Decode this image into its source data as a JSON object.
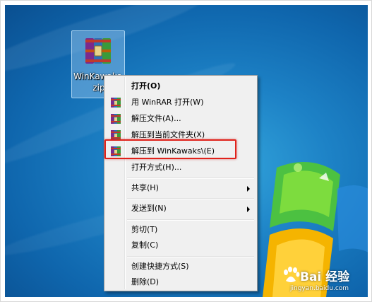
{
  "desktop": {
    "icon": {
      "name": "winrar-archive-icon",
      "label_line1": "WinKawaks.",
      "label_line2": "zip"
    }
  },
  "context_menu": {
    "items": [
      {
        "label": "打开(O)",
        "bold": true,
        "icon": ""
      },
      {
        "label": "用 WinRAR 打开(W)",
        "icon": "winrar-icon"
      },
      {
        "label": "解压文件(A)...",
        "icon": "winrar-icon"
      },
      {
        "label": "解压到当前文件夹(X)",
        "icon": "winrar-icon"
      },
      {
        "label": "解压到 WinKawaks\\(E)",
        "icon": "winrar-icon",
        "highlighted": true
      },
      {
        "label": "打开方式(H)...",
        "icon": ""
      },
      {
        "label": "共享(H)",
        "icon": "",
        "submenu": true
      },
      {
        "label": "发送到(N)",
        "icon": "",
        "submenu": true
      },
      {
        "label": "剪切(T)",
        "icon": ""
      },
      {
        "label": "复制(C)",
        "icon": ""
      },
      {
        "label": "创建快捷方式(S)",
        "icon": ""
      },
      {
        "label": "删除(D)",
        "icon": ""
      }
    ]
  },
  "watermark": {
    "brand": "Bai 经验",
    "url": "jingyan.baidu.com"
  },
  "colors": {
    "highlight_border": "#e0221b",
    "menu_bg": "#f0f0f0",
    "desktop_blue": "#1d82c6"
  }
}
